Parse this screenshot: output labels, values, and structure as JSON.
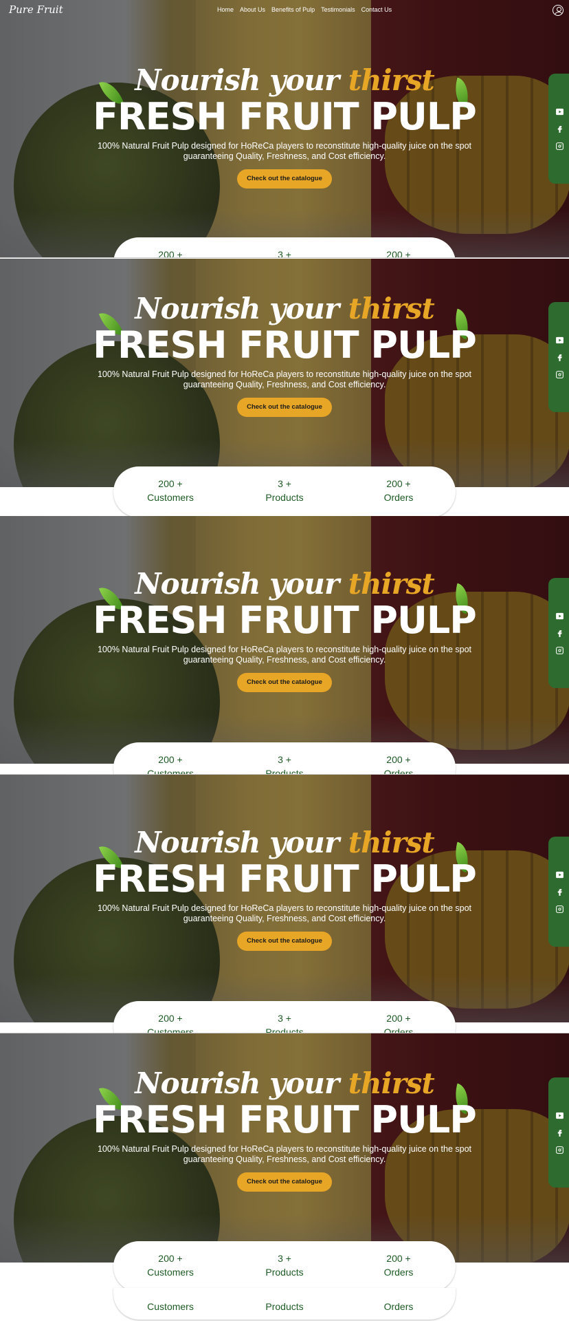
{
  "nav": {
    "logo": "Pure Fruit",
    "links": [
      "Home",
      "About Us",
      "Benefits of Pulp",
      "Testimonials",
      "Contact Us"
    ],
    "account_icon": "user-circle-icon"
  },
  "hero": {
    "script_part1": "Nourish your",
    "script_accent": "thirst",
    "title": "FRESH FRUIT PULP",
    "desc_line1": "100% Natural Fruit Pulp designed for HoReCa players to reconstitute high-quality juice on the spot",
    "desc_line2": "guaranteeing Quality, Freshness, and Cost efficiency.",
    "cta": "Check out the catalogue"
  },
  "stats": [
    {
      "value": "200 +",
      "label": "Customers"
    },
    {
      "value": "3 +",
      "label": "Products"
    },
    {
      "value": "200 +",
      "label": "Orders"
    }
  ],
  "social": [
    "youtube-icon",
    "facebook-icon",
    "instagram-icon"
  ],
  "colors": {
    "accent": "#e8a626",
    "brand_green": "#2e6b2e",
    "stat_text": "#1e5b24"
  }
}
